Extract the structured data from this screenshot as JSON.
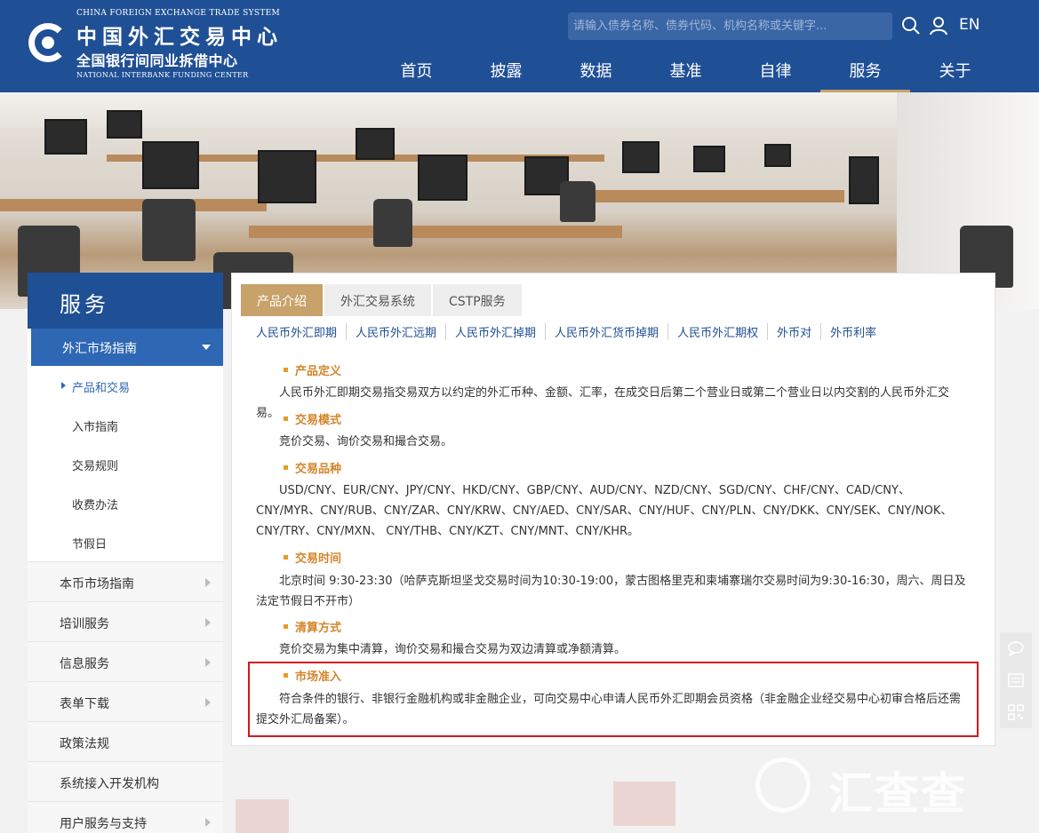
{
  "header": {
    "logo": {
      "en_top": "CHINA FOREIGN EXCHANGE TRADE SYSTEM",
      "cn_top": "中国外汇交易中心",
      "cn_bottom": "全国银行间同业拆借中心",
      "en_bottom": "NATIONAL INTERBANK FUNDING CENTER"
    },
    "search": {
      "placeholder": "请输入债券名称、债券代码、机构名称或关键字..."
    },
    "lang_label": "EN",
    "nav": [
      "首页",
      "披露",
      "数据",
      "基准",
      "自律",
      "服务",
      "关于"
    ],
    "nav_active": "服务"
  },
  "sidebar": {
    "title": "服务",
    "active_section": "外汇市场指南",
    "sub_items": [
      "产品和交易",
      "入市指南",
      "交易规则",
      "收费办法",
      "节假日"
    ],
    "sub_current": "产品和交易",
    "items": [
      "本币市场指南",
      "培训服务",
      "信息服务",
      "表单下载",
      "政策法规",
      "系统接入开发机构",
      "用户服务与支持"
    ]
  },
  "content": {
    "tabs": [
      "产品介绍",
      "外汇交易系统",
      "CSTP服务"
    ],
    "tab_active": "产品介绍",
    "subnav": [
      "人民币外汇即期",
      "人民币外汇远期",
      "人民币外汇掉期",
      "人民币外汇货币掉期",
      "人民币外汇期权",
      "外币对",
      "外币利率"
    ],
    "sections": [
      {
        "title": "产品定义",
        "text": "人民币外汇即期交易指交易双方以约定的外汇币种、金额、汇率，在成交日后第二个营业日或第二个营业日以内交割的人民币外汇交易。"
      },
      {
        "title": "交易模式",
        "text": "竞价交易、询价交易和撮合交易。"
      },
      {
        "title": "交易品种",
        "text": "USD/CNY、EUR/CNY、JPY/CNY、HKD/CNY、GBP/CNY、AUD/CNY、NZD/CNY、SGD/CNY、CHF/CNY、CAD/CNY、CNY/MYR、CNY/RUB、CNY/ZAR、CNY/KRW、CNY/AED、CNY/SAR、CNY/HUF、CNY/PLN、CNY/DKK、CNY/SEK、CNY/NOK、CNY/TRY、CNY/MXN、 CNY/THB、CNY/KZT、CNY/MNT、CNY/KHR。"
      },
      {
        "title": "交易时间",
        "text": "北京时间 9:30-23:30（哈萨克斯坦坚戈交易时间为10:30-19:00，蒙古图格里克和柬埔寨瑞尔交易时间为9:30-16:30，周六、周日及法定节假日不开市）"
      },
      {
        "title": "清算方式",
        "text": "竞价交易为集中清算，询价交易和撮合交易为双边清算或净额清算。"
      },
      {
        "title": "市场准入",
        "text": "符合条件的银行、非银行金融机构或非金融企业，可向交易中心申请人民币外汇即期会员资格（非金融企业经交易中心初审合格后还需提交外汇局备案）。"
      }
    ]
  },
  "watermark": "汇查查",
  "colors": {
    "header_bg": "#1f4f95",
    "accent_gold": "#c8a26a",
    "section_title": "#d4852a",
    "link_blue": "#1f4f95",
    "highlight_border": "#d7151b"
  }
}
